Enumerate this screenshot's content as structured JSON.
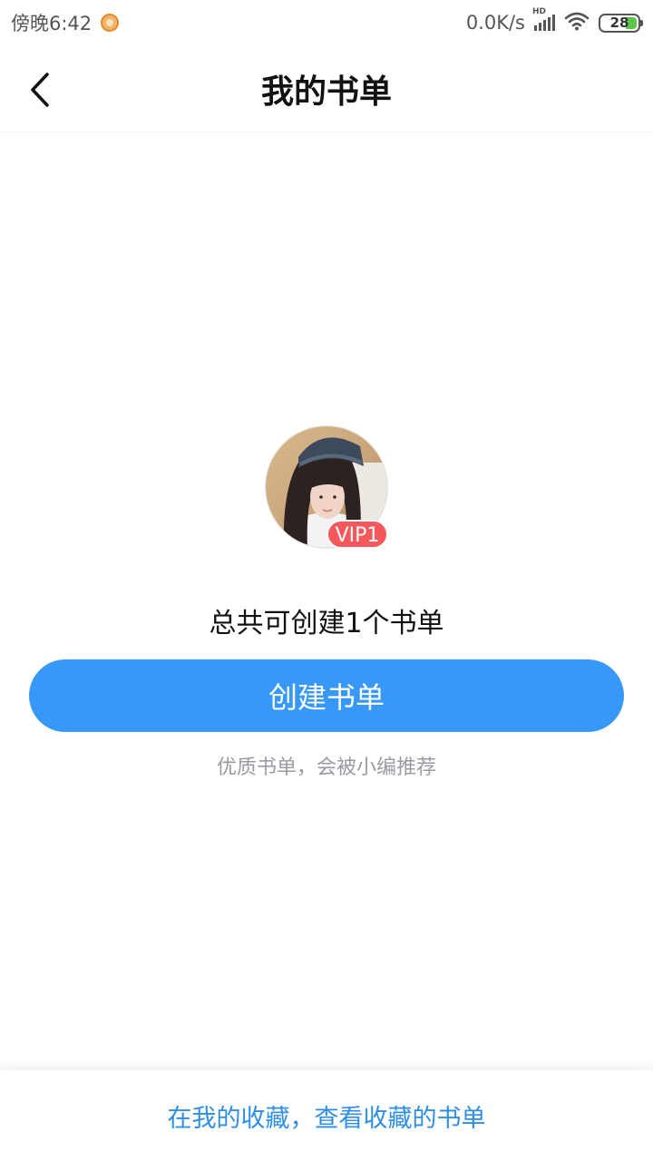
{
  "status_bar": {
    "time": "傍晚6:42",
    "net_speed": "0.0K/s",
    "network_badge": "HD",
    "battery_level": "28",
    "icons": [
      "app-notification-icon",
      "signal-icon",
      "wifi-icon",
      "battery-icon"
    ]
  },
  "header": {
    "title": "我的书单",
    "back_icon": "chevron-left-icon"
  },
  "profile": {
    "vip_badge": "VIP1"
  },
  "main": {
    "limit_text": "总共可创建1个书单",
    "create_button_label": "创建书单",
    "hint_text": "优质书单，会被小编推荐"
  },
  "footer": {
    "link_text": "在我的收藏，查看收藏的书单"
  },
  "colors": {
    "primary": "#3898f8",
    "link": "#2f8fe6",
    "vip": "#f4585a",
    "hint": "#9a9aa2"
  }
}
